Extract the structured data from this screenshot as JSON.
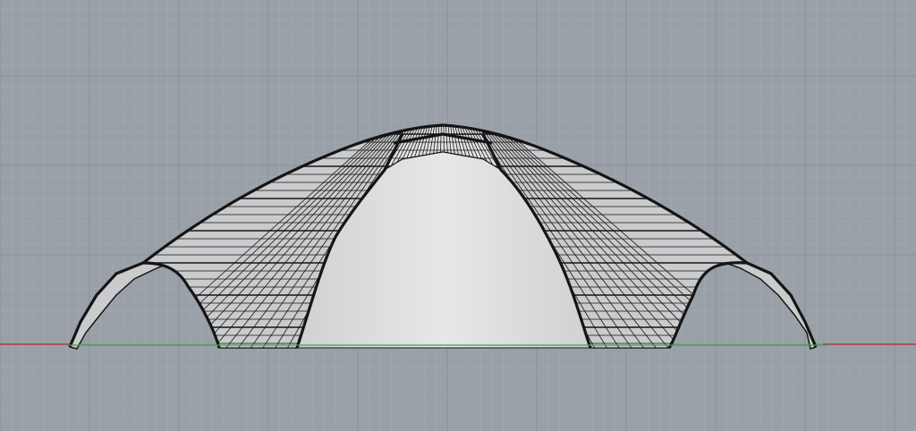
{
  "viewport": {
    "background": "#9aa0a8",
    "grid_minor_color": "#a6abb2",
    "grid_major_color": "#8a9098",
    "x_axis_color": "#b0262a",
    "y_axis_color": "#2fae36",
    "mesh_fill": "#e2e3e4",
    "mesh_shade": "#c9cbcd",
    "mesh_edge": "#151515",
    "model_icon": "dome-shell-mesh"
  }
}
